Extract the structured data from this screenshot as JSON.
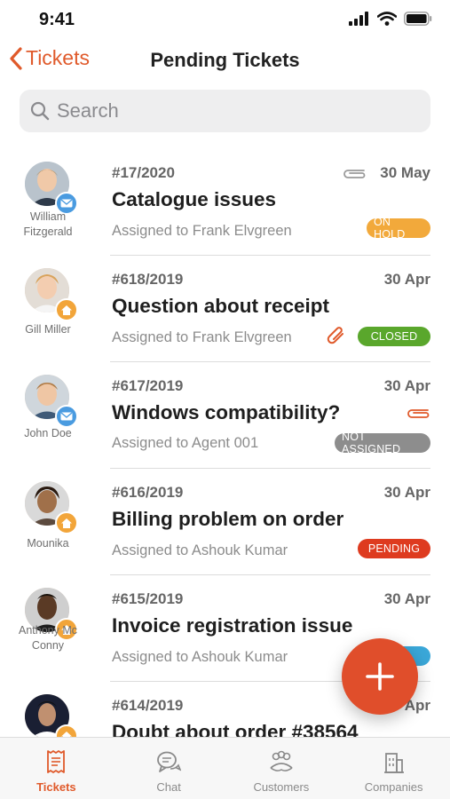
{
  "status_bar": {
    "time": "9:41"
  },
  "nav": {
    "back_label": "Tickets",
    "title": "Pending Tickets"
  },
  "search": {
    "placeholder": "Search",
    "value": ""
  },
  "tickets": [
    {
      "id": "#17/2020",
      "date": "30 May",
      "title": "Catalogue issues",
      "assignee": "Assigned to Frank Elvgreen",
      "customer": "William Fitzgerald",
      "channel": "email",
      "attachment": "gray",
      "status": "ON HOLD"
    },
    {
      "id": "#618/2019",
      "date": "30 Apr",
      "title": "Question about receipt",
      "assignee": "Assigned to Frank Elvgreen",
      "customer": "Gill Miller",
      "channel": "home",
      "attachment": "orange",
      "status": "CLOSED"
    },
    {
      "id": "#617/2019",
      "date": "30 Apr",
      "title": "Windows compatibility?",
      "assignee": "Assigned to Agent 001",
      "customer": "John Doe",
      "channel": "email",
      "attachment": "orange",
      "status": "NOT ASSIGNED"
    },
    {
      "id": "#616/2019",
      "date": "30 Apr",
      "title": "Billing problem on order",
      "assignee": "Assigned to Ashouk Kumar",
      "customer": "Mounika",
      "channel": "home",
      "attachment": "none",
      "status": "PENDING"
    },
    {
      "id": "#615/2019",
      "date": "30 Apr",
      "title": "Invoice registration issue",
      "assignee": "Assigned to Ashouk Kumar",
      "customer": "Anthony Mc Conny",
      "channel": "home",
      "attachment": "none",
      "status": ""
    },
    {
      "id": "#614/2019",
      "date": "Apr",
      "title": "Doubt about order #38564",
      "assignee": "",
      "customer": "",
      "channel": "email",
      "attachment": "none",
      "status": ""
    }
  ],
  "status_colors": {
    "ON HOLD": "#f2a93b",
    "CLOSED": "#5aa72c",
    "NOT ASSIGNED": "#8d8d8d",
    "PENDING": "#de3b1f",
    "OPEN": "#3aa7d8"
  },
  "accent_color": "#e05a2b",
  "fab": {
    "icon": "plus-icon"
  },
  "tab_bar": {
    "tabs": [
      {
        "label": "Tickets",
        "icon": "ticket-icon",
        "active": true
      },
      {
        "label": "Chat",
        "icon": "chat-icon",
        "active": false
      },
      {
        "label": "Customers",
        "icon": "customers-icon",
        "active": false
      },
      {
        "label": "Companies",
        "icon": "companies-icon",
        "active": false
      }
    ]
  }
}
